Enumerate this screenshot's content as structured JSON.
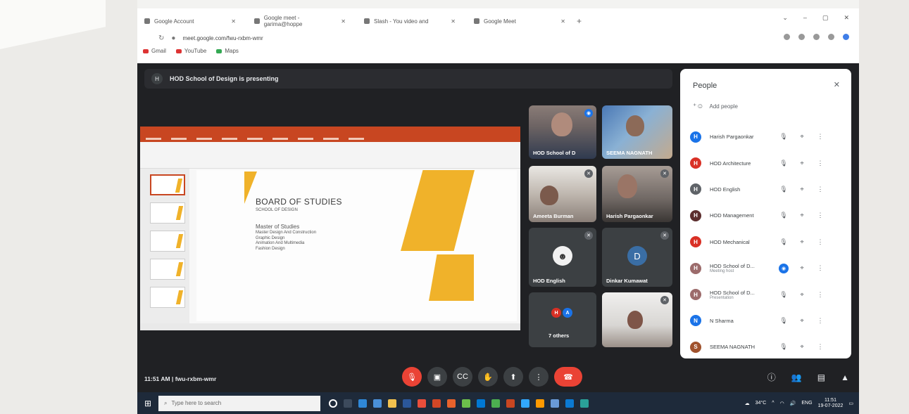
{
  "browser": {
    "tabs": [
      {
        "label": "Google Account"
      },
      {
        "label": "Google meet - garima@hoppe"
      },
      {
        "label": "Slash - You video and"
      },
      {
        "label": "Google Meet"
      }
    ],
    "url": "meet.google.com/fwu-rxbm-wmr",
    "bookmarks": [
      "Gmail",
      "YouTube",
      "Maps"
    ]
  },
  "meet": {
    "presenting_banner": "HOD School of Design is presenting",
    "presenting_initial": "H",
    "meeting_time": "11:51 AM",
    "meeting_separator": "|",
    "meeting_code": "fwu-rxbm-wmr"
  },
  "slide": {
    "title": "BOARD OF STUDIES",
    "subtitle": "SCHOOL OF DESIGN",
    "heading": "Master of Studies",
    "items": [
      "Master Design And Construction",
      "Graphic Design",
      "Animation And Multimedia",
      "Fashion Design"
    ]
  },
  "tiles": [
    {
      "name": "HOD School of D"
    },
    {
      "name": "SEEMA NAGNATH"
    },
    {
      "name": "Ameeta Burman"
    },
    {
      "name": "Harish Pargaonkar"
    },
    {
      "name": "HOD English"
    },
    {
      "name": "Dinkar Kumawat",
      "initial": "D"
    },
    {
      "name": "7 others",
      "initials": [
        "H",
        "A"
      ]
    },
    {
      "name": ""
    }
  ],
  "people_panel": {
    "title": "People",
    "close": "✕",
    "add_people": "Add people",
    "participants": [
      {
        "name": "Harish Pargaonkar",
        "initial": "H",
        "color": "#1a73e8",
        "sub": ""
      },
      {
        "name": "HOD Architecture",
        "initial": "H",
        "color": "#d93025",
        "sub": ""
      },
      {
        "name": "HOD English",
        "initial": "H",
        "color": "#5f6368",
        "sub": ""
      },
      {
        "name": "HOD Management",
        "initial": "H",
        "color": "#5c2e2e",
        "sub": ""
      },
      {
        "name": "HOD Mechanical",
        "initial": "H",
        "color": "#d93025",
        "sub": ""
      },
      {
        "name": "HOD School of D...",
        "initial": "H",
        "color": "#9c6b6b",
        "sub": "Meeting host"
      },
      {
        "name": "HOD School of D...",
        "initial": "H",
        "color": "#9c6b6b",
        "sub": "Presentation"
      },
      {
        "name": "N Sharma",
        "initial": "N",
        "color": "#1a73e8",
        "sub": ""
      },
      {
        "name": "SEEMA NAGNATH",
        "initial": "S",
        "color": "#a0522d",
        "sub": ""
      }
    ]
  },
  "taskbar": {
    "search_placeholder": "Type here to search",
    "weather": "34°C",
    "lang": "ENG",
    "time": "11:51",
    "date": "19-07-2022"
  },
  "colors": {
    "meet_bg": "#202124",
    "accent_red": "#ea4335",
    "ppt_orange": "#c84621",
    "slide_yellow": "#f0b22a"
  }
}
